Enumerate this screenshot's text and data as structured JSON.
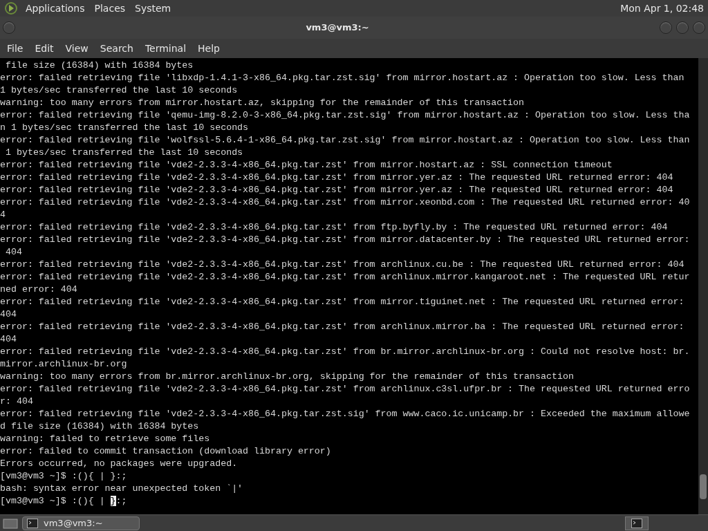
{
  "top_panel": {
    "menus": [
      "Applications",
      "Places",
      "System"
    ],
    "clock": "Mon Apr 1, 02:48"
  },
  "window": {
    "title": "vm3@vm3:~"
  },
  "menubar": [
    "File",
    "Edit",
    "View",
    "Search",
    "Terminal",
    "Help"
  ],
  "terminal": {
    "lines": [
      " file size (16384) with 16384 bytes",
      "error: failed retrieving file 'libxdp-1.4.1-3-x86_64.pkg.tar.zst.sig' from mirror.hostart.az : Operation too slow. Less than",
      "1 bytes/sec transferred the last 10 seconds",
      "warning: too many errors from mirror.hostart.az, skipping for the remainder of this transaction",
      "error: failed retrieving file 'qemu-img-8.2.0-3-x86_64.pkg.tar.zst.sig' from mirror.hostart.az : Operation too slow. Less tha",
      "n 1 bytes/sec transferred the last 10 seconds",
      "error: failed retrieving file 'wolfssl-5.6.4-1-x86_64.pkg.tar.zst.sig' from mirror.hostart.az : Operation too slow. Less than",
      " 1 bytes/sec transferred the last 10 seconds",
      "error: failed retrieving file 'vde2-2.3.3-4-x86_64.pkg.tar.zst' from mirror.hostart.az : SSL connection timeout",
      "error: failed retrieving file 'vde2-2.3.3-4-x86_64.pkg.tar.zst' from mirror.yer.az : The requested URL returned error: 404",
      "error: failed retrieving file 'vde2-2.3.3-4-x86_64.pkg.tar.zst' from mirror.yer.az : The requested URL returned error: 404",
      "error: failed retrieving file 'vde2-2.3.3-4-x86_64.pkg.tar.zst' from mirror.xeonbd.com : The requested URL returned error: 40",
      "4",
      "error: failed retrieving file 'vde2-2.3.3-4-x86_64.pkg.tar.zst' from ftp.byfly.by : The requested URL returned error: 404",
      "error: failed retrieving file 'vde2-2.3.3-4-x86_64.pkg.tar.zst' from mirror.datacenter.by : The requested URL returned error:",
      " 404",
      "error: failed retrieving file 'vde2-2.3.3-4-x86_64.pkg.tar.zst' from archlinux.cu.be : The requested URL returned error: 404",
      "error: failed retrieving file 'vde2-2.3.3-4-x86_64.pkg.tar.zst' from archlinux.mirror.kangaroot.net : The requested URL retur",
      "ned error: 404",
      "error: failed retrieving file 'vde2-2.3.3-4-x86_64.pkg.tar.zst' from mirror.tiguinet.net : The requested URL returned error:",
      "404",
      "error: failed retrieving file 'vde2-2.3.3-4-x86_64.pkg.tar.zst' from archlinux.mirror.ba : The requested URL returned error:",
      "404",
      "error: failed retrieving file 'vde2-2.3.3-4-x86_64.pkg.tar.zst' from br.mirror.archlinux-br.org : Could not resolve host: br.",
      "mirror.archlinux-br.org",
      "warning: too many errors from br.mirror.archlinux-br.org, skipping for the remainder of this transaction",
      "error: failed retrieving file 'vde2-2.3.3-4-x86_64.pkg.tar.zst' from archlinux.c3sl.ufpr.br : The requested URL returned erro",
      "r: 404",
      "error: failed retrieving file 'vde2-2.3.3-4-x86_64.pkg.tar.zst.sig' from www.caco.ic.unicamp.br : Exceeded the maximum allowe",
      "d file size (16384) with 16384 bytes",
      "warning: failed to retrieve some files",
      "error: failed to commit transaction (download library error)",
      "Errors occurred, no packages were upgraded.",
      "[vm3@vm3 ~]$ :(){ | }:;",
      "bash: syntax error near unexpected token `|'"
    ],
    "input_line": {
      "before": "[vm3@vm3 ~]$ :(){ | ",
      "cursor": "}",
      "after": ":;"
    }
  },
  "taskbar": {
    "tasks": [
      {
        "label": "vm3@vm3:~",
        "selected": true
      }
    ]
  }
}
